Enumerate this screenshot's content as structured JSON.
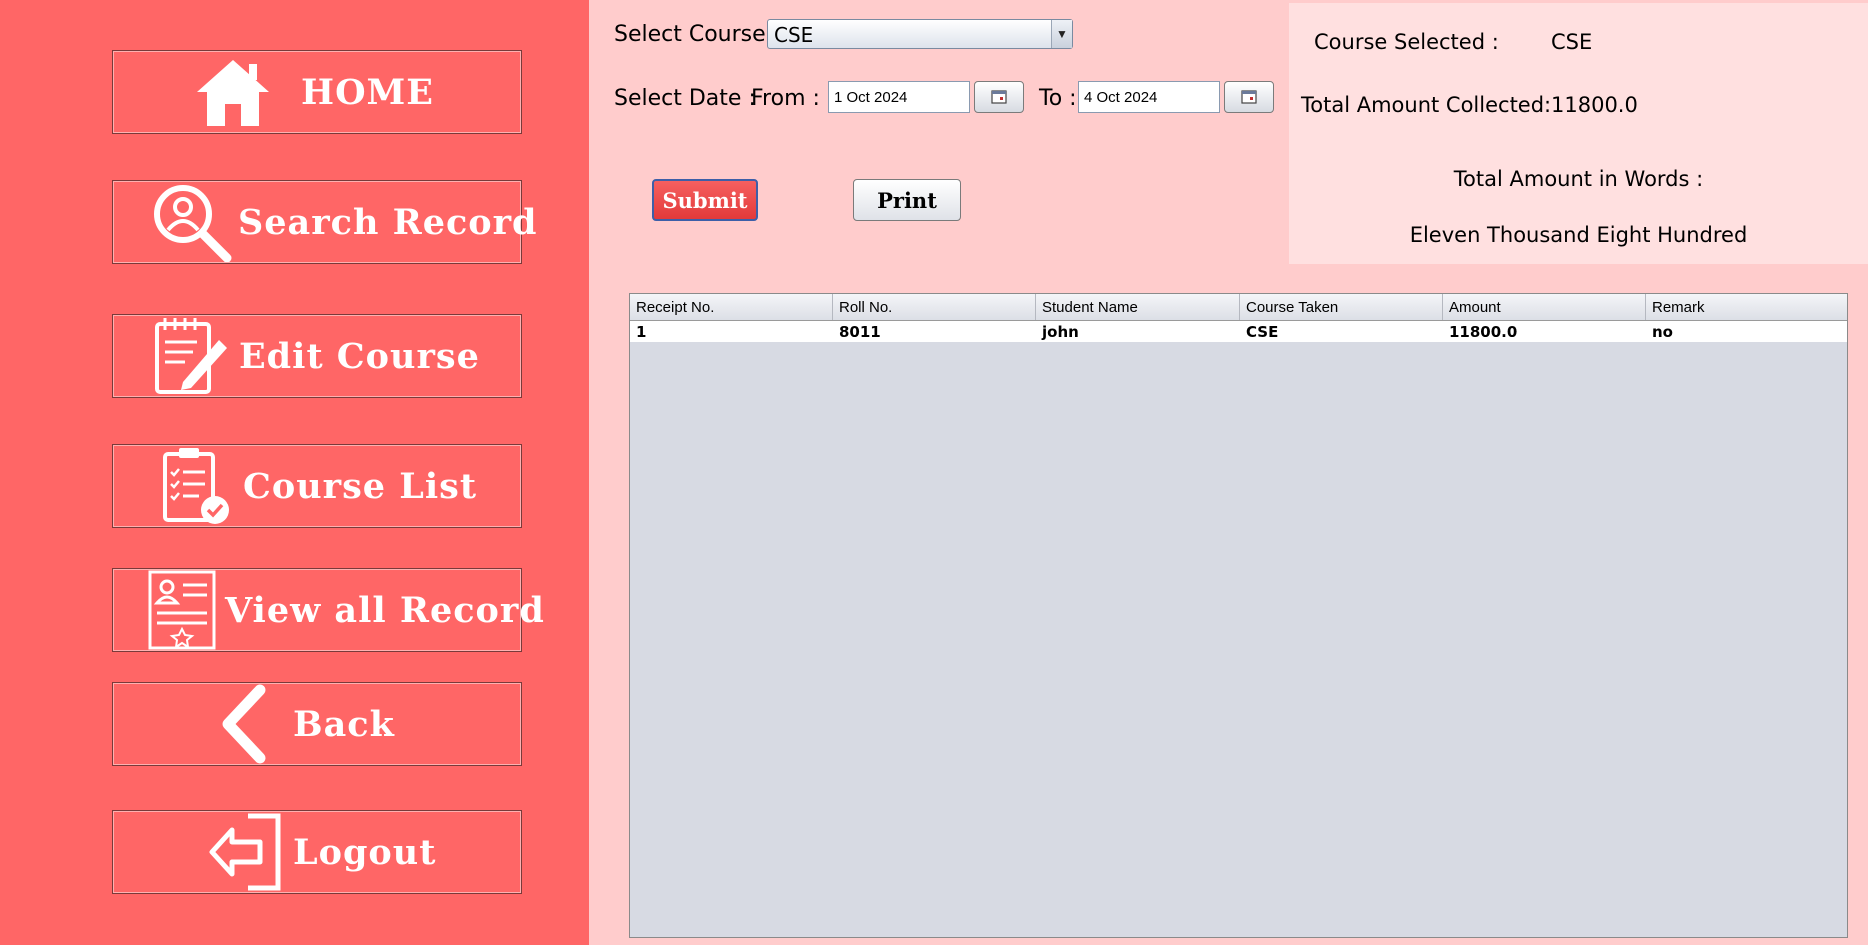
{
  "sidebar": {
    "items": [
      {
        "label": "HOME",
        "icon": "home-icon"
      },
      {
        "label": "Search Record",
        "icon": "search-user-icon"
      },
      {
        "label": "Edit Course",
        "icon": "edit-document-icon"
      },
      {
        "label": "Course List",
        "icon": "checklist-clipboard-icon"
      },
      {
        "label": "View all Record",
        "icon": "certificate-record-icon"
      },
      {
        "label": "Back",
        "icon": "chevron-left-icon"
      },
      {
        "label": "Logout",
        "icon": "logout-icon"
      }
    ]
  },
  "filters": {
    "course_label": "Select Course :",
    "course_value": "CSE",
    "date_label": "Select Date :",
    "from_label": "From :",
    "from_value": "1 Oct 2024",
    "to_label": "To :",
    "to_value": "4 Oct 2024"
  },
  "actions": {
    "submit_label": "Submit",
    "print_label": "Print"
  },
  "summary": {
    "course_selected_label": "Course Selected :",
    "course_selected_value": "CSE",
    "total_collected_label": "Total Amount Collected:",
    "total_collected_value": "11800.0",
    "words_label": "Total Amount in Words :",
    "words_value": "Eleven Thousand Eight Hundred"
  },
  "table": {
    "columns": [
      "Receipt No.",
      "Roll No.",
      "Student Name",
      "Course Taken",
      "Amount",
      "Remark"
    ],
    "rows": [
      [
        "1",
        "8011",
        "john",
        "CSE",
        "11800.0",
        "no"
      ]
    ]
  },
  "colors": {
    "sidebar_bg": "#ff6666",
    "page_bg": "#ffcccc",
    "summary_bg": "#ffe0e0",
    "submit_bg": "#ee3b3b",
    "table_bg": "#d7dae3"
  }
}
